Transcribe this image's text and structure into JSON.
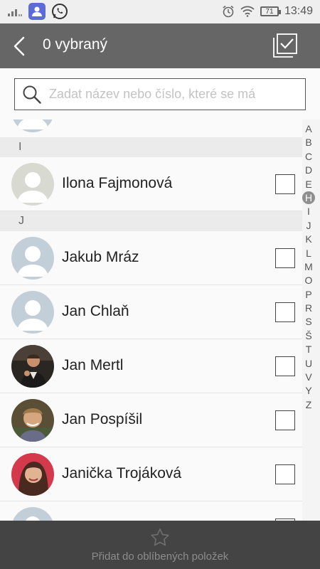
{
  "status_bar": {
    "time": "13:49",
    "battery": "71",
    "icons": [
      "signal-icon",
      "contacts-app-icon",
      "whatsapp-icon",
      "alarm-icon",
      "wifi-icon",
      "battery-icon"
    ]
  },
  "header": {
    "title": "0 vybraný",
    "back_icon": "back-arrow-icon",
    "select_all_icon": "select-all-icon"
  },
  "search": {
    "placeholder": "Zadat název nebo číslo, které se má",
    "value": ""
  },
  "sections": [
    {
      "letter": "I"
    },
    {
      "letter": "J"
    }
  ],
  "contacts": [
    {
      "name": "Ilona Fajmonová",
      "avatar": "default",
      "selected": false
    },
    {
      "name": "Jakub Mráz",
      "avatar": "default",
      "selected": false
    },
    {
      "name": "Jan Chlaň",
      "avatar": "default",
      "selected": false
    },
    {
      "name": "Jan Mertl",
      "avatar": "photo",
      "selected": false
    },
    {
      "name": "Jan Pospíšil",
      "avatar": "photo",
      "selected": false
    },
    {
      "name": "Janička Trojáková",
      "avatar": "photo",
      "selected": false
    }
  ],
  "index": {
    "letters": [
      "A",
      "B",
      "C",
      "D",
      "E",
      "H",
      "I",
      "J",
      "K",
      "L",
      "M",
      "O",
      "P",
      "R",
      "S",
      "Š",
      "T",
      "U",
      "V",
      "Y",
      "Z"
    ],
    "active": "H"
  },
  "bottom_bar": {
    "label": "Přidat do oblíbených položek",
    "icon": "star-icon"
  },
  "colors": {
    "header_bg": "#666666",
    "bottom_bar_bg": "#444444",
    "section_bg": "#ebebeb",
    "default_avatar_bg": "#c3cfd8"
  }
}
